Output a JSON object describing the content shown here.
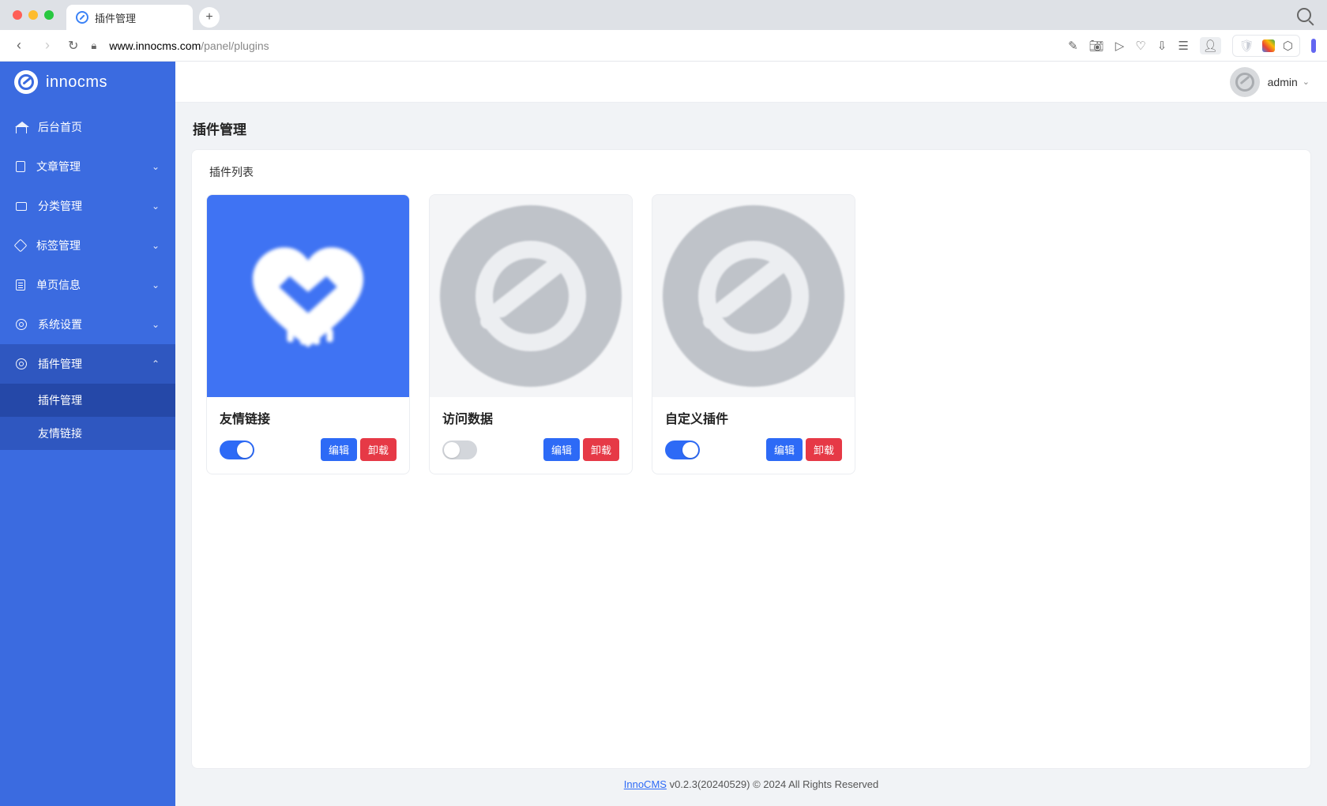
{
  "browser": {
    "tab_title": "插件管理",
    "url_domain": "www.innocms.com",
    "url_path": "/panel/plugins"
  },
  "brand": "innocms",
  "sidebar": {
    "items": [
      {
        "label": "后台首页",
        "expandable": false
      },
      {
        "label": "文章管理",
        "expandable": true
      },
      {
        "label": "分类管理",
        "expandable": true
      },
      {
        "label": "标签管理",
        "expandable": true
      },
      {
        "label": "单页信息",
        "expandable": true
      },
      {
        "label": "系统设置",
        "expandable": true
      },
      {
        "label": "插件管理",
        "expandable": true,
        "active": true
      }
    ],
    "submenu": [
      {
        "label": "插件管理",
        "selected": true
      },
      {
        "label": "友情链接",
        "selected": false
      }
    ]
  },
  "topbar": {
    "username": "admin"
  },
  "page": {
    "title": "插件管理",
    "panel_title": "插件列表"
  },
  "plugins": [
    {
      "title": "友情链接",
      "enabled": true,
      "icon": "heart",
      "btn_edit": "编辑",
      "btn_uninstall": "卸载"
    },
    {
      "title": "访问数据",
      "enabled": false,
      "icon": "placeholder",
      "btn_edit": "编辑",
      "btn_uninstall": "卸载"
    },
    {
      "title": "自定义插件",
      "enabled": true,
      "icon": "placeholder",
      "btn_edit": "编辑",
      "btn_uninstall": "卸载"
    }
  ],
  "footer": {
    "link_text": "InnoCMS",
    "version_text": " v0.2.3(20240529) © 2024 All Rights Reserved"
  }
}
